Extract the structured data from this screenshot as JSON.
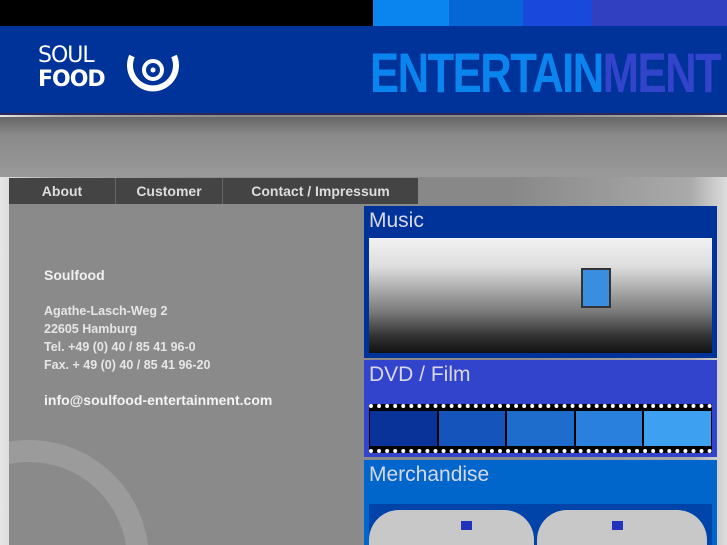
{
  "colors": {
    "header": "#003399",
    "music": "#003399",
    "dvd": "#3344cc",
    "merch": "#0066cc",
    "strip": [
      "#0a84ee",
      "#0566d6",
      "#1848dc",
      "#3040c0"
    ]
  },
  "logo": {
    "line1": "SOUL",
    "line2": "FOOD",
    "icon": "record-ring-icon"
  },
  "banner": {
    "part1": "ENTERTAIN",
    "part2": "MENT"
  },
  "nav": [
    {
      "label": "About"
    },
    {
      "label": "Customer"
    },
    {
      "label": "Contact / Impressum"
    }
  ],
  "contact": {
    "name": "Soulfood",
    "street": "Agathe-Lasch-Weg 2",
    "city": "22605 Hamburg",
    "tel": "Tel. +49 (0) 40 / 85 41 96-0",
    "fax": "Fax. + 49 (0) 40 / 85 41 96-20",
    "email": "info@soulfood-entertainment.com"
  },
  "panels": [
    {
      "title": "Music",
      "image": "turntable-image"
    },
    {
      "title": "DVD / Film",
      "image": "filmstrip-image"
    },
    {
      "title": "Merchandise",
      "image": "tshirts-image"
    }
  ]
}
